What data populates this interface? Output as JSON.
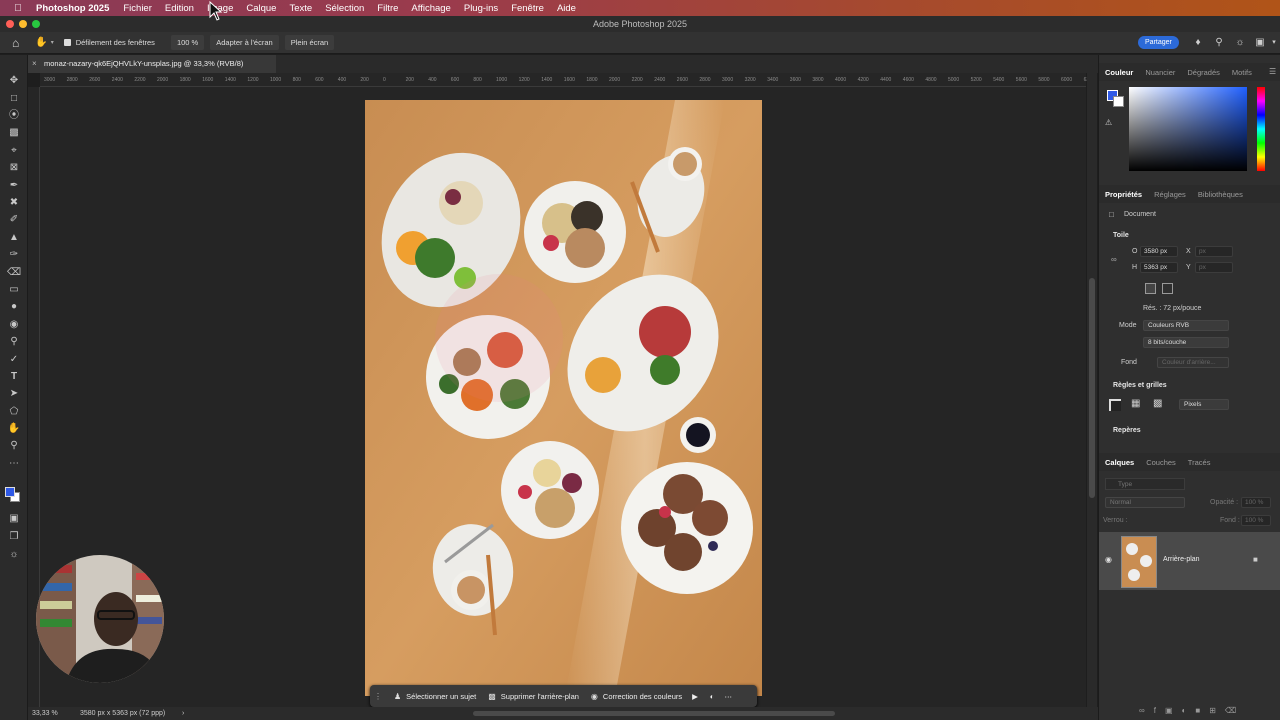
{
  "menubar": {
    "app": "Photoshop 2025",
    "items": [
      "Fichier",
      "Edition",
      "Image",
      "Calque",
      "Texte",
      "Sélection",
      "Filtre",
      "Affichage",
      "Plug-ins",
      "Fenêtre",
      "Aide"
    ]
  },
  "window": {
    "title": "Adobe Photoshop 2025"
  },
  "options": {
    "scroll_all": "Défilement des fenêtres",
    "zoom": "100 %",
    "fit": "Adapter à l'écran",
    "full": "Plein écran",
    "share": "Partager"
  },
  "document": {
    "tab": "monaz-nazary-qk6EjQHVLkY-unsplas.jpg @ 33,3% (RVB/8)"
  },
  "rulers": {
    "h_ticks": [
      "3000",
      "2800",
      "2600",
      "2400",
      "2200",
      "2000",
      "1800",
      "1600",
      "1400",
      "1200",
      "1000",
      "800",
      "600",
      "400",
      "200",
      "0",
      "200",
      "400",
      "600",
      "800",
      "1000",
      "1200",
      "1400",
      "1600",
      "1800",
      "2000",
      "2200",
      "2400",
      "2600",
      "2800",
      "3000",
      "3200",
      "3400",
      "3600",
      "3800",
      "4000",
      "4200",
      "4400",
      "4600",
      "4800",
      "5000",
      "5200",
      "5400",
      "5600",
      "5800",
      "6000",
      "6200",
      "6400"
    ]
  },
  "contextbar": {
    "select_subject": "Sélectionner un sujet",
    "remove_bg": "Supprimer l'arrière-plan",
    "color_correction": "Correction des couleurs"
  },
  "status": {
    "zoom": "33,33 %",
    "info": "3580 px x 5363 px (72 ppp)"
  },
  "color_panel": {
    "tabs": [
      "Couleur",
      "Nuancier",
      "Dégradés",
      "Motifs"
    ],
    "fg": "#2f59e6",
    "bg": "#ffffff"
  },
  "properties": {
    "tabs": [
      "Propriétés",
      "Réglages",
      "Bibliothèques"
    ],
    "document_label": "Document",
    "canvas_section": "Toile",
    "w_label": "O",
    "w_value": "3580 px",
    "x_label": "X",
    "x_unit": "px",
    "h_label": "H",
    "h_value": "5363 px",
    "y_label": "Y",
    "y_unit": "px",
    "resolution": "Rés. : 72 px/pouce",
    "mode_label": "Mode",
    "mode_value": "Couleurs RVB",
    "depth_value": "8 bits/couche",
    "fill_label": "Fond",
    "fill_value": "Couleur d'arrière...",
    "rulers_section": "Règles et grilles",
    "units_value": "Pixels",
    "guides_section": "Repères"
  },
  "layers": {
    "tabs": [
      "Calques",
      "Couches",
      "Tracés"
    ],
    "search_placeholder": "Type",
    "blend": "Normal",
    "opacity_label": "Opacité :",
    "opacity_value": "100 %",
    "lock_label": "Verrou :",
    "fill_label": "Fond :",
    "fill_value": "100 %",
    "items": [
      {
        "name": "Arrière-plan"
      }
    ]
  }
}
